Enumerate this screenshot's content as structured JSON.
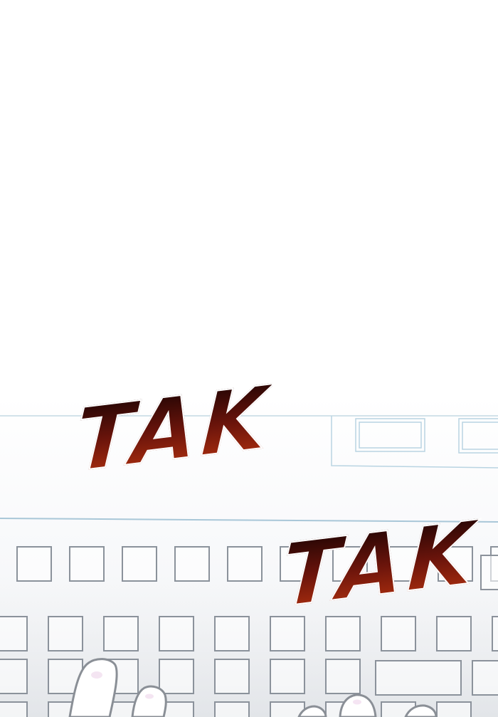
{
  "sound_effects": [
    {
      "text": "TAK"
    },
    {
      "text": "TAK"
    }
  ],
  "colors": {
    "sfx_top": "#1e0403",
    "sfx_bottom": "#b5320f",
    "key_outline": "#8b929b",
    "desk_line": "#a9c7d8"
  }
}
